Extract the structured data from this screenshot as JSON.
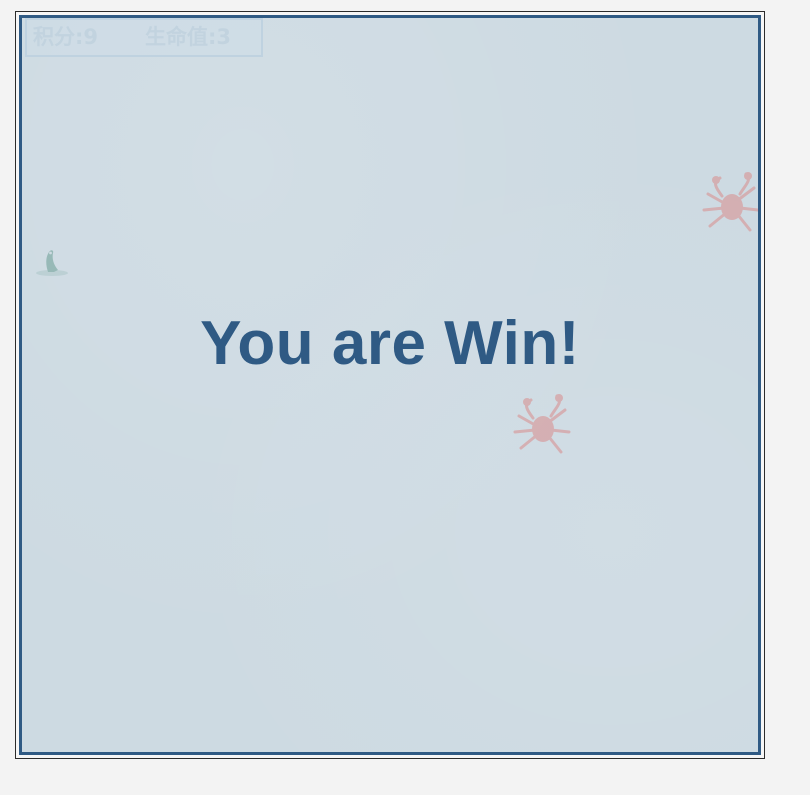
{
  "hud": {
    "score_label": "积分:9",
    "lives_label": "生命值:3",
    "score": 9,
    "lives": 3
  },
  "message": {
    "text": "You are Win!"
  },
  "sprites": [
    {
      "name": "crab-icon",
      "kind": "enemy"
    },
    {
      "name": "crab-icon",
      "kind": "enemy"
    },
    {
      "name": "fish-icon",
      "kind": "player"
    }
  ],
  "colors": {
    "background": "#f3f3f3",
    "board": "#cddae2",
    "border": "#2f5a84",
    "message": "#2f5a84",
    "crab": "#d98c8c",
    "fish": "#6a9e94"
  }
}
